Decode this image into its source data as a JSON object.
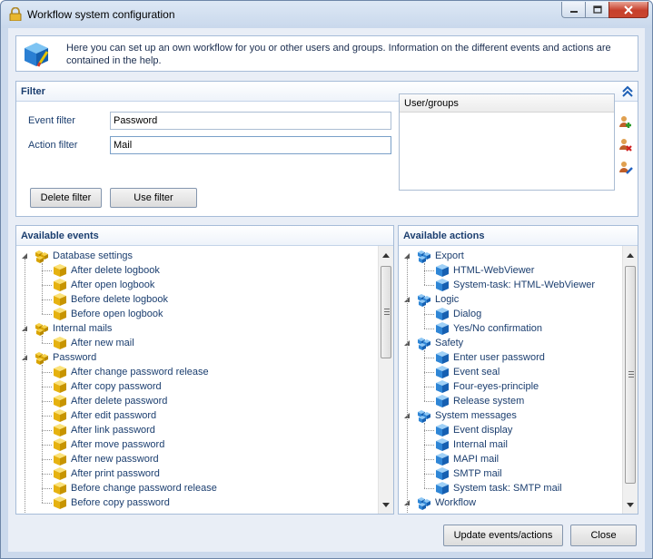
{
  "window": {
    "title": "Workflow system configuration"
  },
  "info": {
    "text": "Here you can set up an own workflow for you or other users and groups. Information on the different events and actions are contained in the help."
  },
  "filter": {
    "heading": "Filter",
    "event_label": "Event filter",
    "event_value": "Password",
    "action_label": "Action filter",
    "action_value": "Mail",
    "delete_button": "Delete filter",
    "use_button": "Use filter",
    "usergroups_header": "User/groups"
  },
  "events": {
    "heading": "Available events",
    "groups": [
      {
        "label": "Database settings",
        "items": [
          "After delete logbook",
          "After open logbook",
          "Before delete logbook",
          "Before open logbook"
        ]
      },
      {
        "label": "Internal mails",
        "items": [
          "After new mail"
        ]
      },
      {
        "label": "Password",
        "items": [
          "After change password release",
          "After copy password",
          "After delete password",
          "After edit password",
          "After link password",
          "After move password",
          "After new password",
          "After print password",
          "Before change password release",
          "Before copy password"
        ]
      }
    ]
  },
  "actions": {
    "heading": "Available actions",
    "groups": [
      {
        "label": "Export",
        "items": [
          "HTML-WebViewer",
          "System-task: HTML-WebViewer"
        ]
      },
      {
        "label": "Logic",
        "items": [
          "Dialog",
          "Yes/No confirmation"
        ]
      },
      {
        "label": "Safety",
        "items": [
          "Enter user password",
          "Event seal",
          "Four-eyes-principle",
          "Release system"
        ]
      },
      {
        "label": "System messages",
        "items": [
          "Event display",
          "Internal mail",
          "MAPI mail",
          "SMTP mail",
          "System task: SMTP mail"
        ]
      },
      {
        "label": "Workflow",
        "items": []
      }
    ]
  },
  "footer": {
    "update_button": "Update events/actions",
    "close_button": "Close"
  },
  "colors": {
    "accent": "#1b3e6f",
    "panel_border": "#a6bcd8",
    "background": "#e9eef6"
  }
}
